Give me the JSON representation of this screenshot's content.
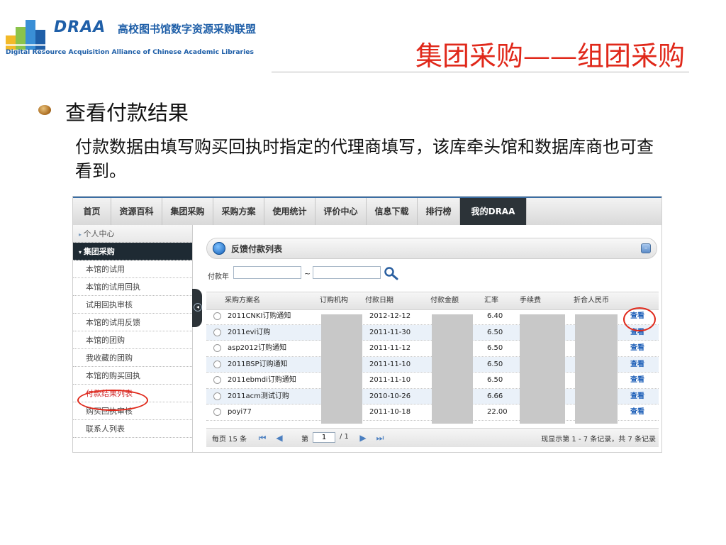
{
  "logo": {
    "brand": "DRAA",
    "name_cn": "高校图书馆数字资源采购联盟",
    "tagline": "Digital Resource Acquisition Alliance of Chinese Academic Libraries"
  },
  "slide": {
    "title": "集团采购——组团采购",
    "bullet": "查看付款结果",
    "body": "付款数据由填写购买回执时指定的代理商填写，该库牵头馆和数据库商也可查看到。"
  },
  "nav": [
    "首页",
    "资源百科",
    "集团采购",
    "采购方案",
    "使用统计",
    "评价中心",
    "信息下载",
    "排行榜",
    "我的DRAA"
  ],
  "sidebar": {
    "section1": "个人中心",
    "section2": "集团采购",
    "items": [
      "本馆的试用",
      "本馆的试用回执",
      "试用回执审核",
      "本馆的试用反馈",
      "本馆的团购",
      "我收藏的团购",
      "本馆的购买回执",
      "付款结果列表",
      "购买回执审核",
      "联系人列表"
    ]
  },
  "panel": {
    "title": "反馈付款列表",
    "filter_label": "付款年",
    "filter_sep": "~"
  },
  "table": {
    "headers": [
      "采购方案名",
      "订购机构",
      "付款日期",
      "付款金额",
      "汇率",
      "手续费",
      "折合人民币"
    ],
    "rows": [
      {
        "name": "2011CNKI订购通知",
        "date": "2012-12-12",
        "rate": "6.40",
        "action": "查看"
      },
      {
        "name": "2011evi订购",
        "date": "2011-11-30",
        "rate": "6.50",
        "action": "查看"
      },
      {
        "name": "asp2012订购通知",
        "date": "2011-11-12",
        "rate": "6.50",
        "action": "查看"
      },
      {
        "name": "2011BSP订购通知",
        "date": "2011-11-10",
        "rate": "6.50",
        "action": "查看"
      },
      {
        "name": "2011ebmdi订购通知",
        "date": "2011-11-10",
        "rate": "6.50",
        "action": "查看"
      },
      {
        "name": "2011acm测试订购",
        "date": "2010-10-26",
        "rate": "6.66",
        "action": "查看"
      },
      {
        "name": "poyi77",
        "date": "2011-10-18",
        "rate": "22.00",
        "action": "查看"
      }
    ]
  },
  "pager": {
    "per_page": "每页 15 条",
    "page_prefix": "第",
    "page_value": "1",
    "page_total": "/ 1",
    "summary": "现显示第 1 - 7 条记录，共 7 条记录"
  },
  "colors": {
    "title_red": "#e0281a",
    "brand_blue": "#1f5fa8",
    "nav_active": "#2c3338",
    "link_blue": "#1d5fb8",
    "highlight_ring": "#e0281a"
  }
}
